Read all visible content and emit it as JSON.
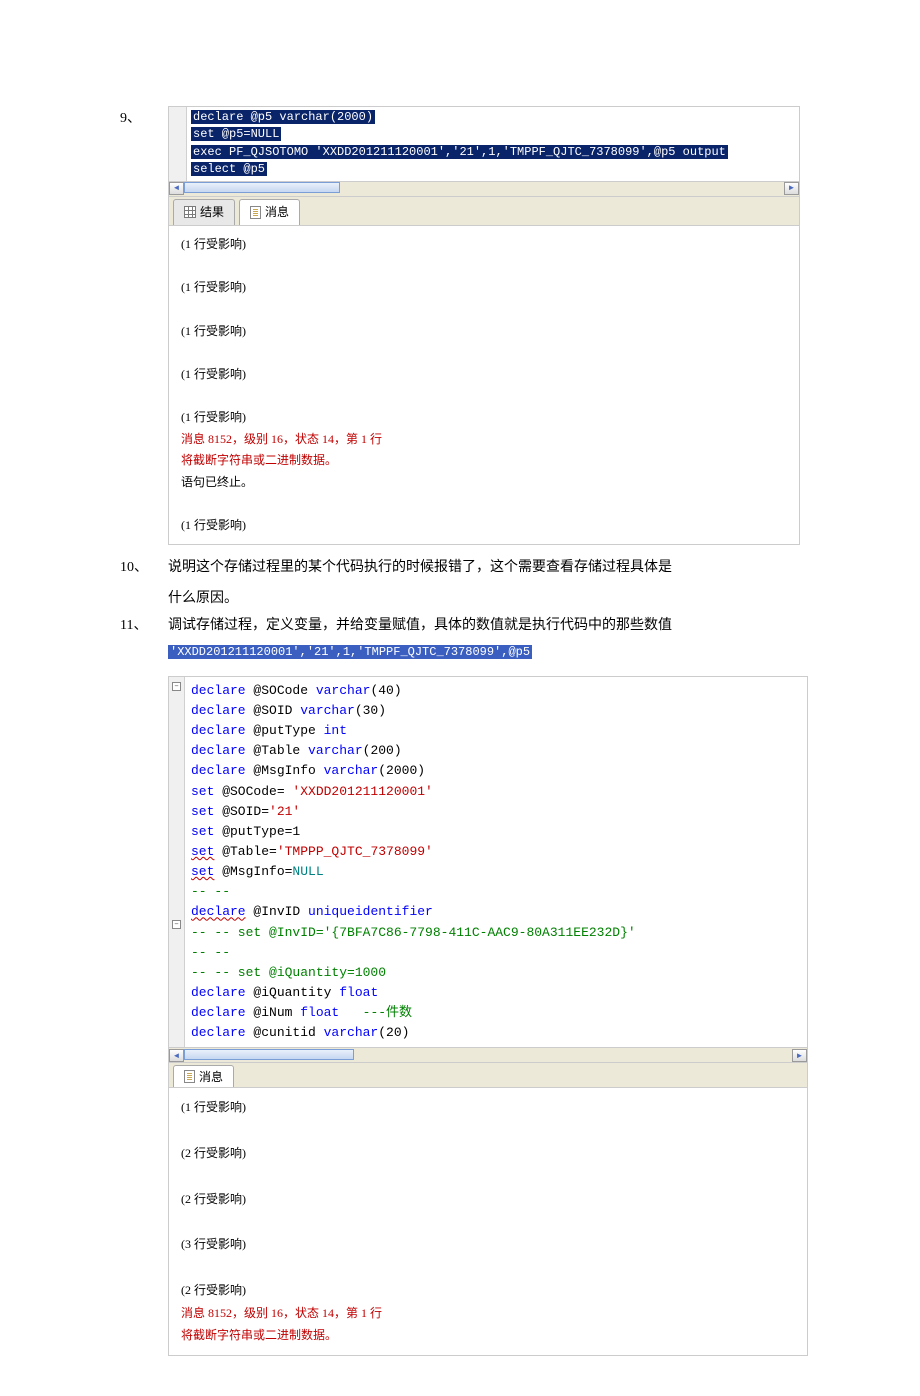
{
  "screenshot1": {
    "code_lines": [
      "declare @p5 varchar(2000)",
      "set @p5=NULL",
      "exec PF_QJSOTOMO 'XXDD201211120001','21',1,'TMPPF_QJTC_7378099',@p5 output",
      "select @p5"
    ],
    "tabs": {
      "results": "结果",
      "messages": "消息"
    },
    "msgs": [
      "(1 行受影响)",
      "(1 行受影响)",
      "(1 行受影响)",
      "(1 行受影响)",
      "(1 行受影响)"
    ],
    "err1": "消息 8152，级别 16，状态 14，第 1 行",
    "err2": "将截断字符串或二进制数据。",
    "term": "语句已终止。",
    "last": "(1 行受影响)"
  },
  "items": {
    "n9": "9、",
    "n10": "10、",
    "t10a": "说明这个存储过程里的某个代码执行的时候报错了，这个需要查看存储过程具体是",
    "t10b": "什么原因。",
    "n11": "11、",
    "t11": "调试存储过程，定义变量，并给变量赋值，具体的数值就是执行代码中的那些数值",
    "params_hl": "'XXDD201211120001','21',1,'TMPPF_QJTC_7378099',@p5"
  },
  "screenshot2": {
    "code": {
      "l1_a": "declare",
      "l1_b": " @SOCode ",
      "l1_c": "varchar",
      "l1_d": "(40)",
      "l2_a": "declare",
      "l2_b": " @SOID ",
      "l2_c": "varchar",
      "l2_d": "(30)",
      "l3_a": "declare",
      "l3_b": " @putType ",
      "l3_c": "int",
      "l4_a": "declare",
      "l4_b": " @Table ",
      "l4_c": "varchar",
      "l4_d": "(200)",
      "l5_a": "declare",
      "l5_b": " @MsgInfo ",
      "l5_c": "varchar",
      "l5_d": "(2000)",
      "l6_a": "set",
      "l6_b": " @SOCode= ",
      "l6_c": "'XXDD201211120001'",
      "l7_a": "set",
      "l7_b": " @SOID=",
      "l7_c": "'21'",
      "l8_a": "set",
      "l8_b": " @putType=1",
      "l9_a": "set",
      "l9_b": " @Table=",
      "l9_c": "'TMPPP_QJTC_7378099'",
      "l10_a": "set",
      "l10_b": " @MsgInfo=",
      "l10_c": "NULL",
      "l11": "-- --",
      "l12_a": "declare",
      "l12_b": " @InvID ",
      "l12_c": "uniqueidentifier",
      "l13": "-- -- set @InvID='{7BFA7C86-7798-411C-AAC9-80A311EE232D}'",
      "l14": "-- --",
      "l15": "-- -- set @iQuantity=1000",
      "l16_a": "declare",
      "l16_b": " @iQuantity ",
      "l16_c": "float",
      "l17_a": "declare",
      "l17_b": " @iNum ",
      "l17_c": "float",
      "l17_d": "   ",
      "l17_e": "---件数",
      "l18_a": "declare",
      "l18_b": " @cunitid ",
      "l18_c": "varchar",
      "l18_d": "(20)"
    },
    "tab": "消息",
    "msgs": [
      "(1 行受影响)",
      "(2 行受影响)",
      "(2 行受影响)",
      "(3 行受影响)",
      "(2 行受影响)"
    ],
    "err1": "消息 8152，级别 16，状态 14，第 1 行",
    "err2": "将截断字符串或二进制数据。"
  }
}
